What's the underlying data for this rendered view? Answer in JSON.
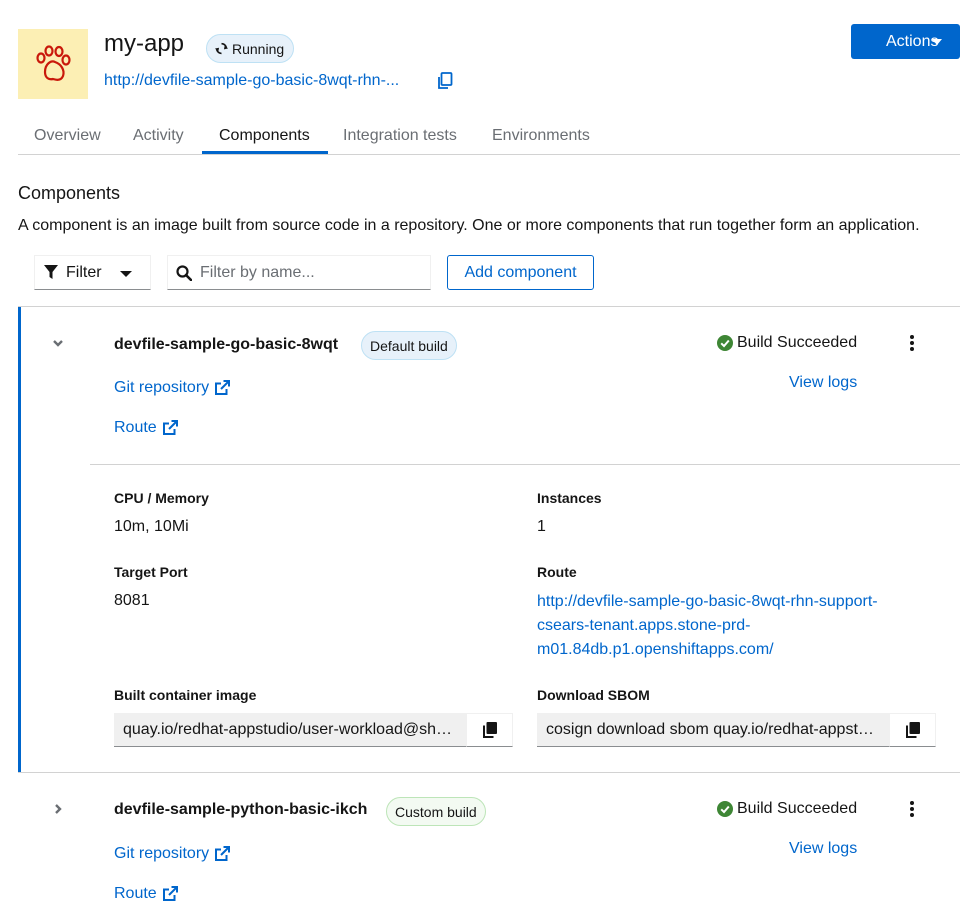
{
  "app": {
    "title": "my-app",
    "status": "Running",
    "url": "http://devfile-sample-go-basic-8wqt-rhn-..."
  },
  "actions": {
    "label": "Actions"
  },
  "tabs": [
    {
      "label": "Overview"
    },
    {
      "label": "Activity"
    },
    {
      "label": "Components"
    },
    {
      "label": "Integration tests"
    },
    {
      "label": "Environments"
    }
  ],
  "active_tab": "Components",
  "section": {
    "title": "Components",
    "description": "A component is an image built from source code in a repository. One or more components that run together form an application."
  },
  "toolbar": {
    "filter_label": "Filter",
    "search_placeholder": "Filter by name...",
    "add_component_label": "Add component"
  },
  "components": [
    {
      "name": "devfile-sample-go-basic-8wqt",
      "badge": "Default build",
      "build_status": "Build Succeeded",
      "view_logs": "View logs",
      "git_repo_label": "Git repository",
      "route_label": "Route",
      "expanded": true,
      "details": {
        "cpu_memory_label": "CPU / Memory",
        "cpu_memory_value": "10m, 10Mi",
        "instances_label": "Instances",
        "instances_value": "1",
        "target_port_label": "Target Port",
        "target_port_value": "8081",
        "route_label": "Route",
        "route_lines": [
          "http://devfile-sample-go-basic-8wqt-rhn-support-",
          "csears-tenant.apps.stone-prd-",
          "m01.84db.p1.openshiftapps.com/"
        ],
        "built_image_label": "Built container image",
        "built_image_value": "quay.io/redhat-appstudio/user-workload@sha256",
        "sbom_label": "Download SBOM",
        "sbom_value": "cosign download sbom quay.io/redhat-appstudio"
      }
    },
    {
      "name": "devfile-sample-python-basic-ikch",
      "badge": "Custom build",
      "build_status": "Build Succeeded",
      "view_logs": "View logs",
      "git_repo_label": "Git repository",
      "route_label": "Route",
      "expanded": false
    }
  ],
  "colors": {
    "accent": "#0066cc",
    "success": "#3e8635",
    "app_icon_bg": "#fcefb4",
    "app_icon_fg": "#c9190b"
  },
  "icons": {
    "app": "paw-icon",
    "status": "sync-icon",
    "copy": "copy-icon",
    "filter": "filter-icon",
    "search": "search-icon",
    "external": "external-link-icon",
    "success": "check-circle-icon",
    "kebab": "kebab-menu-icon"
  }
}
